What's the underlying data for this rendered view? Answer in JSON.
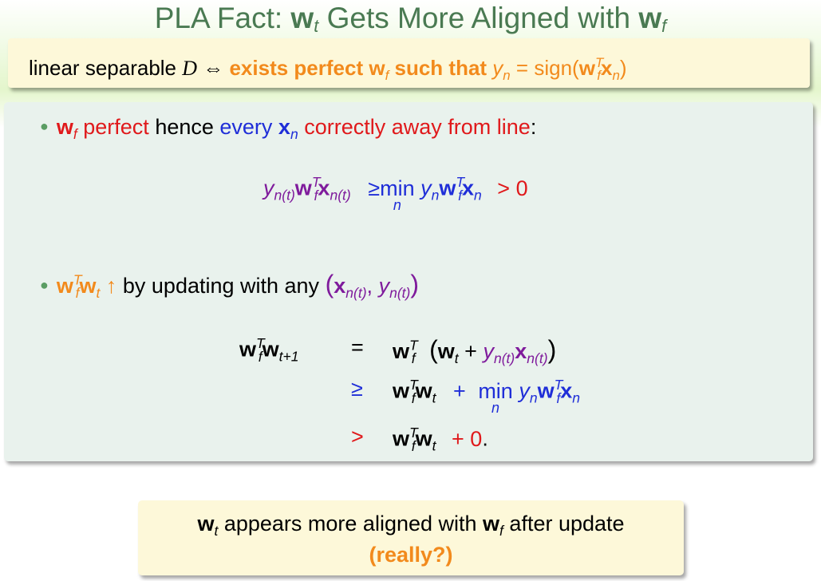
{
  "title": {
    "prefix": "PLA Fact: ",
    "w": "w",
    "t": "t",
    "middle": " Gets More Aligned with ",
    "f": "f"
  },
  "fact": {
    "text1": "linear separable ",
    "D": "D",
    "iff": " ⇔ ",
    "text2": "exists perfect ",
    "w": "w",
    "f": "f",
    "text3": " such that ",
    "y": "y",
    "n": "n",
    "eq": " = sign(",
    "T": "T",
    "x": "x",
    "close": ")"
  },
  "bullet1": {
    "w": "w",
    "f": "f",
    "perfect": " perfect",
    "hence": " hence ",
    "every": "every ",
    "x": "x",
    "n": "n",
    "correctly": " correctly away from line",
    "colon": ":"
  },
  "eq1": {
    "y": "y",
    "nt": "n(t)",
    "w": "w",
    "T": "T",
    "f": "f",
    "x": "x",
    "ge": "≥",
    "min": "min",
    "n": "n",
    "gt": "> 0"
  },
  "bullet2": {
    "w": "w",
    "T": "T",
    "f": "f",
    "t": "t",
    "up": " ↑",
    "text": " by updating with any ",
    "lp": "(",
    "x": "x",
    "nt": "n(t)",
    "comma": ", ",
    "y": "y",
    "rp": ")"
  },
  "eq2": {
    "line1": {
      "w": "w",
      "T": "T",
      "f": "f",
      "t1": "t+1",
      "eq": "=",
      "lp": "(",
      "t": "t",
      "plus": " + ",
      "y": "y",
      "nt": "n(t)",
      "x": "x",
      "rp": ")"
    },
    "line2": {
      "ge": "≥",
      "w": "w",
      "T": "T",
      "f": "f",
      "t": "t",
      "plus": "+",
      "min": "min",
      "n": "n",
      "y": "y",
      "x": "x"
    },
    "line3": {
      "gt": ">",
      "w": "w",
      "T": "T",
      "f": "f",
      "t": "t",
      "plus0": "+ 0",
      "dot": "."
    }
  },
  "note": {
    "w": "w",
    "t": "t",
    "text": " appears more aligned with ",
    "w2": "w",
    "f": "f",
    "text2": " after update",
    "really": "(really?)"
  },
  "colors": {
    "title": "#4a7a52",
    "orange": "#f28a1c",
    "red": "#e0191b",
    "blue": "#1f2ed8",
    "purple": "#7f1b9c",
    "box_yellow": "#fdf8d9",
    "box_green": "#e9f2ed"
  }
}
